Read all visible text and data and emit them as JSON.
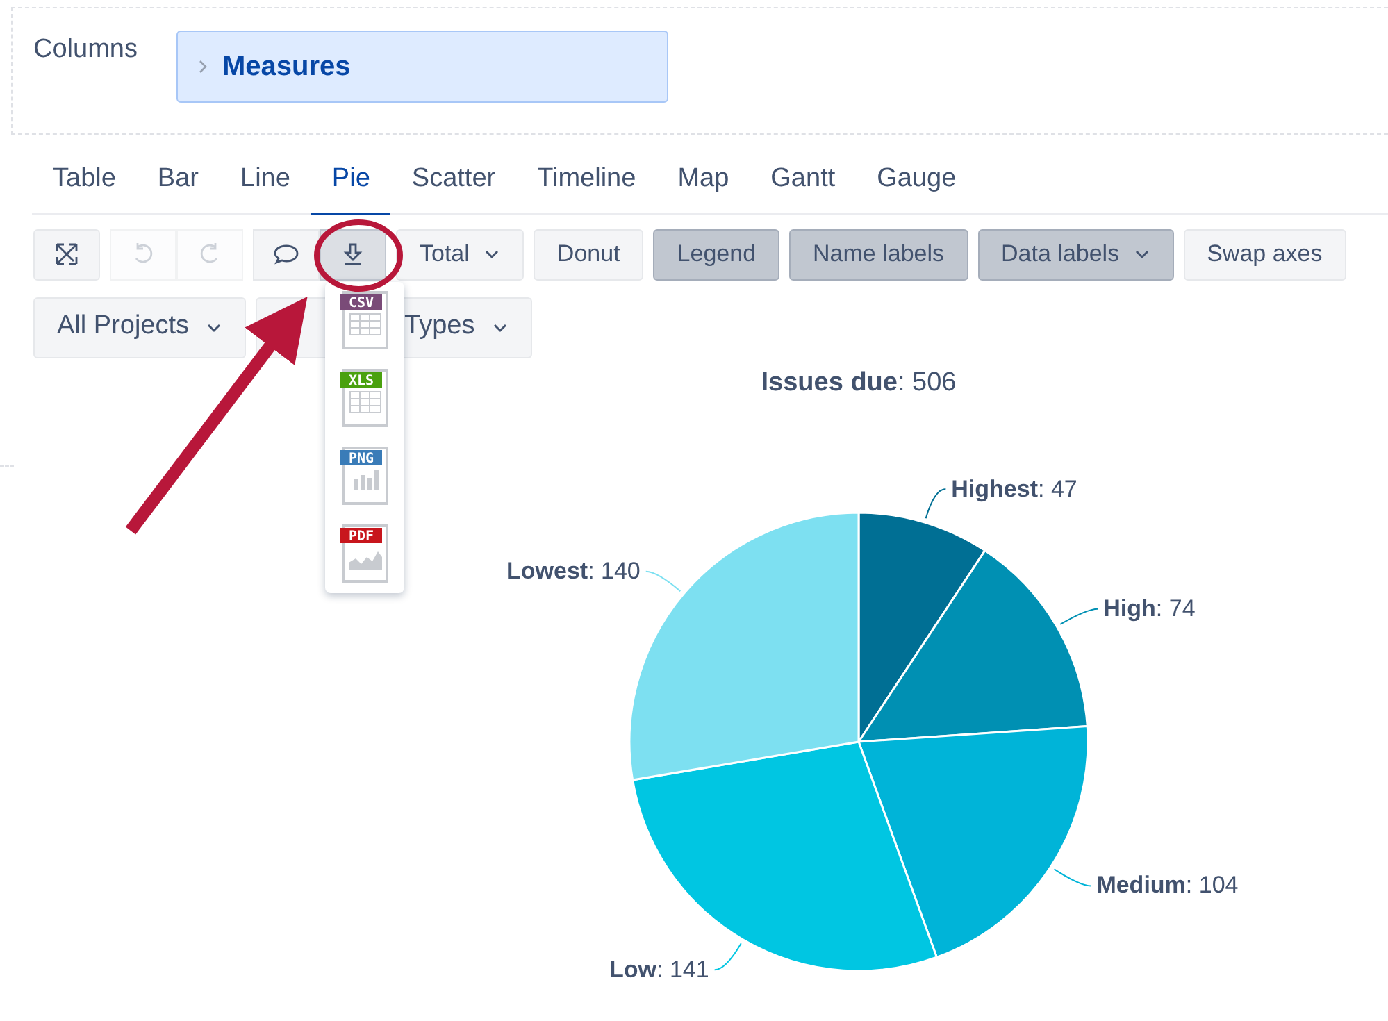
{
  "columns_label": "Columns",
  "columns_chip": {
    "label": "Measures",
    "expanded": false
  },
  "tabs": [
    {
      "label": "Table",
      "selected": false
    },
    {
      "label": "Bar",
      "selected": false
    },
    {
      "label": "Line",
      "selected": false
    },
    {
      "label": "Pie",
      "selected": true
    },
    {
      "label": "Scatter",
      "selected": false
    },
    {
      "label": "Timeline",
      "selected": false
    },
    {
      "label": "Map",
      "selected": false
    },
    {
      "label": "Gantt",
      "selected": false
    },
    {
      "label": "Gauge",
      "selected": false
    }
  ],
  "icon_buttons": [
    {
      "kind": "expand",
      "disabled": false,
      "active": false
    },
    {
      "kind": "undo",
      "disabled": true,
      "active": false
    },
    {
      "kind": "redo",
      "disabled": true,
      "active": false
    },
    {
      "kind": "comment",
      "disabled": false,
      "active": false
    },
    {
      "kind": "download",
      "disabled": false,
      "active": true
    }
  ],
  "toolbar_buttons": [
    {
      "label": "Total",
      "dropdown": true,
      "selected": false
    },
    {
      "label": "Donut",
      "dropdown": false,
      "selected": false
    },
    {
      "label": "Legend",
      "dropdown": false,
      "selected": true
    },
    {
      "label": "Name labels",
      "dropdown": false,
      "selected": true
    },
    {
      "label": "Data labels",
      "dropdown": true,
      "selected": true
    },
    {
      "label": "Swap axes",
      "dropdown": false,
      "selected": false
    }
  ],
  "filters": [
    {
      "label": "All Projects",
      "dropdown": true
    },
    {
      "label": "Types",
      "dropdown": true
    }
  ],
  "export_menu": [
    {
      "label": "CSV",
      "kind": "table",
      "color": "#7a4b78"
    },
    {
      "label": "XLS",
      "kind": "table",
      "color": "#4aa10f"
    },
    {
      "label": "PNG",
      "kind": "bars",
      "color": "#3a7cb8"
    },
    {
      "label": "PDF",
      "kind": "area",
      "color": "#c8161d"
    }
  ],
  "chart": {
    "chart_data": {
      "type": "pie",
      "title": "**Issues due**: 506",
      "categories": [
        "Highest",
        "High",
        "Medium",
        "Low",
        "Lowest"
      ],
      "values": [
        47,
        74,
        104,
        141,
        140
      ],
      "colors": [
        "#006f94",
        "#0090b3",
        "#00b4d8",
        "#00c6e2",
        "#7de0f1"
      ],
      "value_labels": [
        ": 47",
        ": 74",
        ": 104",
        ": 141",
        ": 140"
      ]
    }
  },
  "callout": {
    "color": "#b8173a"
  }
}
